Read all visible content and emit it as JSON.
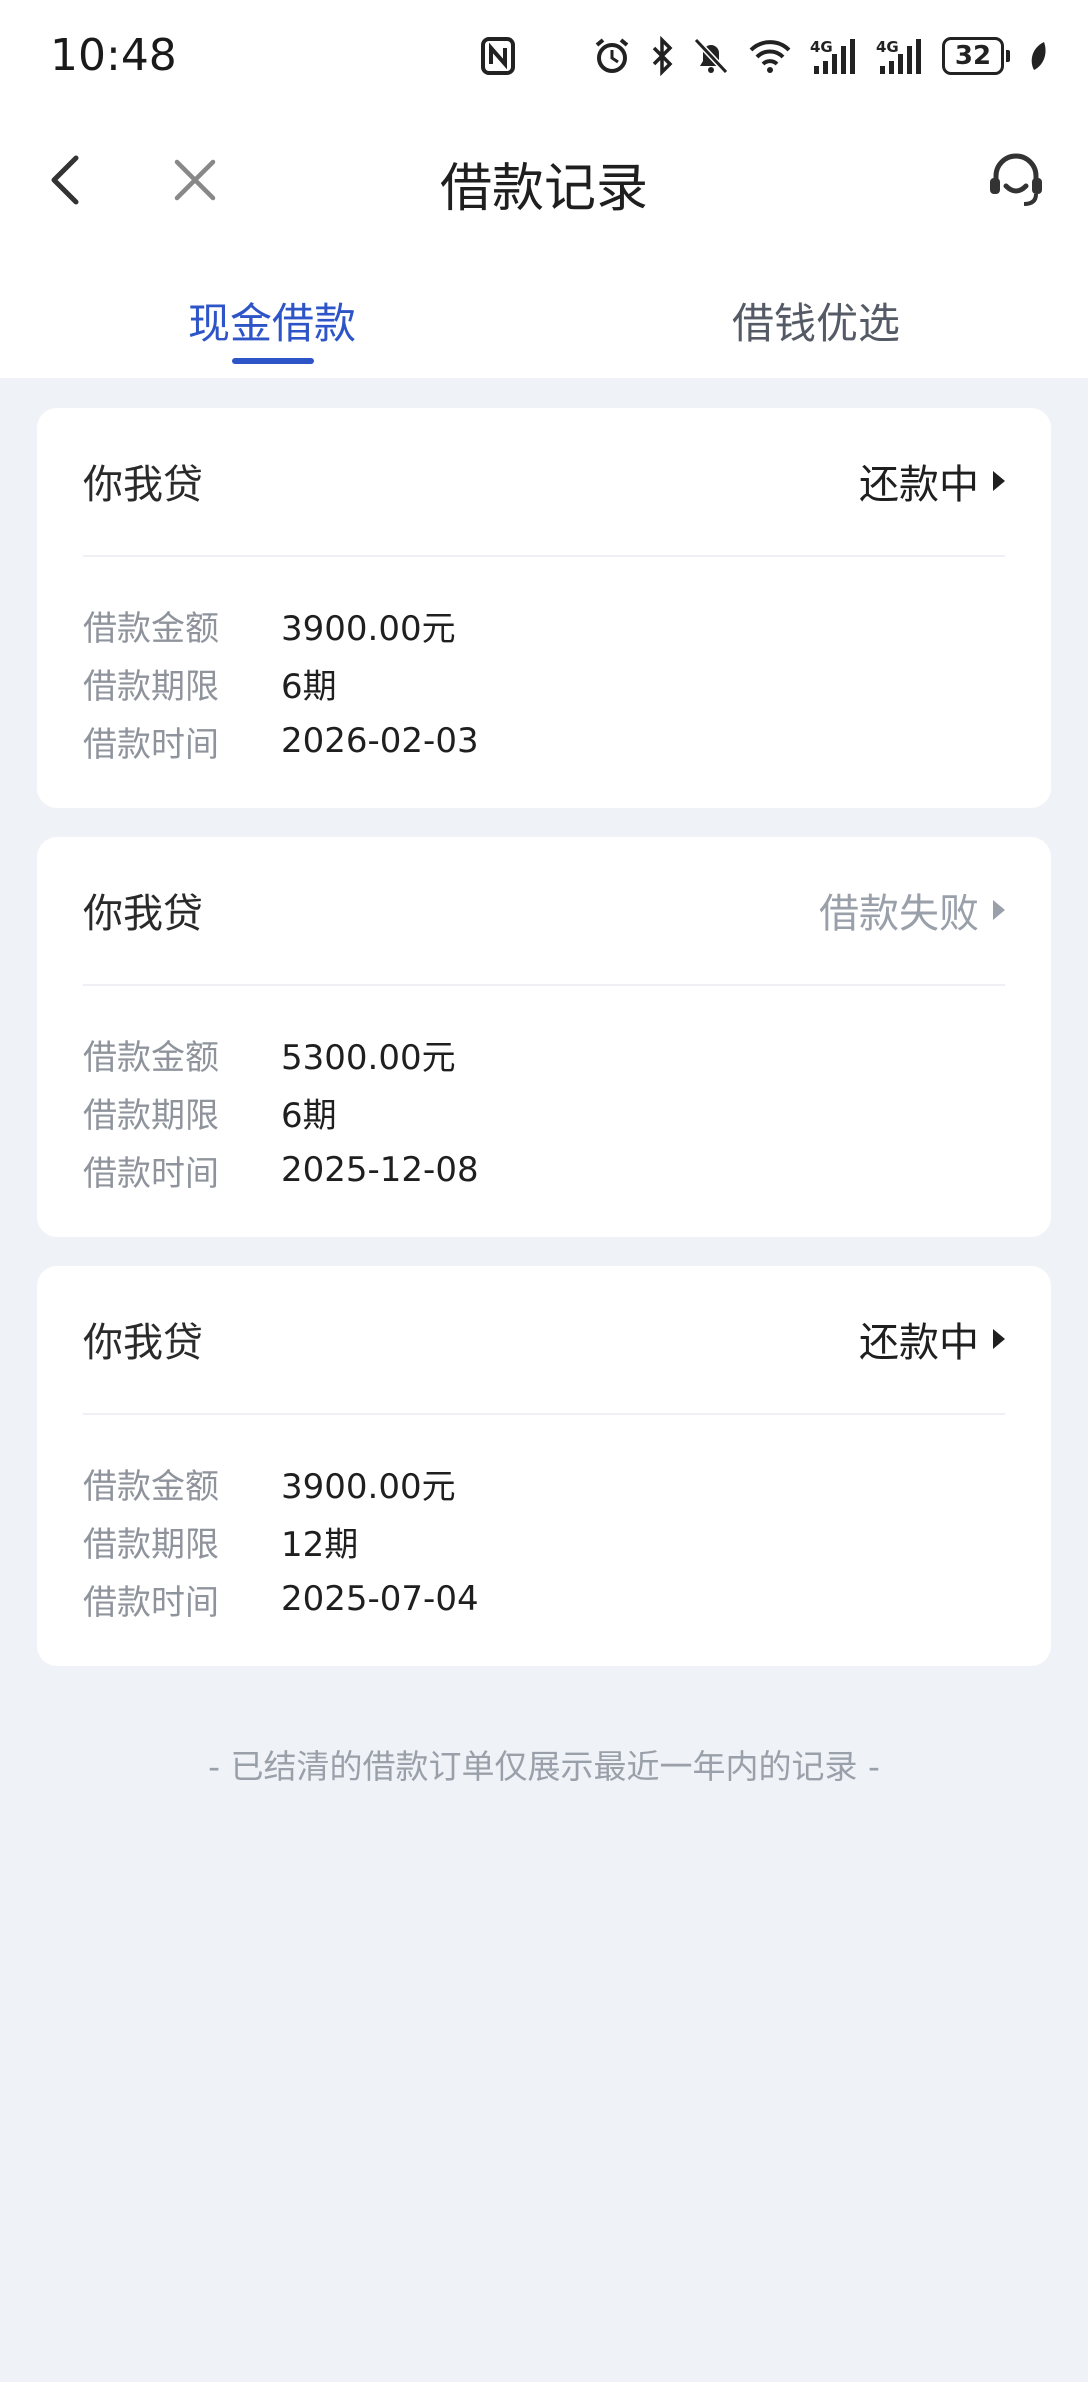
{
  "status_bar": {
    "time": "10:48",
    "battery": "32"
  },
  "nav": {
    "title": "借款记录"
  },
  "tabs": [
    {
      "label": "现金借款",
      "active": true
    },
    {
      "label": "借钱优选",
      "active": false
    }
  ],
  "field_labels": {
    "amount": "借款金额",
    "term": "借款期限",
    "time": "借款时间"
  },
  "loans": [
    {
      "lender": "你我贷",
      "status": "还款中",
      "status_type": "normal",
      "amount": "3900.00元",
      "term": "6期",
      "time": "2026-02-03"
    },
    {
      "lender": "你我贷",
      "status": "借款失败",
      "status_type": "failed",
      "amount": "5300.00元",
      "term": "6期",
      "time": "2025-12-08"
    },
    {
      "lender": "你我贷",
      "status": "还款中",
      "status_type": "normal",
      "amount": "3900.00元",
      "term": "12期",
      "time": "2025-07-04"
    }
  ],
  "footer_note": "- 已结清的借款订单仅展示最近一年内的记录 -",
  "colors": {
    "accent": "#2e55c8",
    "background": "#eff2f7",
    "muted": "#9aa0aa"
  }
}
